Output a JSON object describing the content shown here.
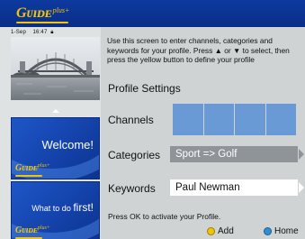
{
  "header": {
    "logo_text": "Gᴜɪᴅᴇ",
    "logo_plus": "plus+"
  },
  "status": {
    "date": "1-Sep",
    "time": "16:47",
    "lock_icon": "lock-icon"
  },
  "instructions": "Use this screen to enter channels, categories and keywords for your profile.  Press ▲ or ▼ to select, then press the yellow button to define your profile",
  "profile": {
    "title": "Profile Settings",
    "channels_label": "Channels",
    "channel_slots": 4,
    "categories_label": "Categories",
    "categories_value": "Sport => Golf",
    "keywords_label": "Keywords",
    "keywords_value": "Paul Newman"
  },
  "panels": {
    "welcome": {
      "text": "Welcome!",
      "logo": "Gᴜɪᴅᴇ",
      "logo_plus": "plus+"
    },
    "first": {
      "text_small": "What to do ",
      "text_big": "first!",
      "logo": "Gᴜɪᴅᴇ",
      "logo_plus": "plus+"
    }
  },
  "footer": {
    "ok_text": "Press OK to activate your Profile.",
    "add_label": "Add",
    "home_label": "Home"
  },
  "colors": {
    "header_blue": "#0d3aa0",
    "accent_yellow": "#f5c400",
    "channel_box": "#6a9ad6",
    "category_bg": "#8f9499",
    "home_dot": "#2f8fd6"
  }
}
